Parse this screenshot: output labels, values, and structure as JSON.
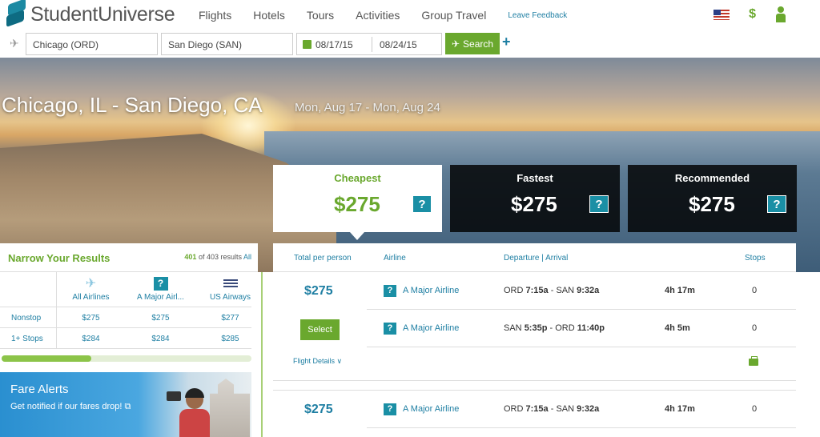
{
  "brand": {
    "name": "StudentUniverse"
  },
  "nav": {
    "links": [
      "Flights",
      "Hotels",
      "Tours",
      "Activities",
      "Group Travel"
    ],
    "feedback": "Leave Feedback",
    "currency_symbol": "$"
  },
  "search": {
    "from": "Chicago (ORD)",
    "to": "San Diego (SAN)",
    "depart_date": "08/17/15",
    "return_date": "08/24/15",
    "search_label": "Search",
    "add_label": "+"
  },
  "hero": {
    "route": "Chicago, IL - San Diego, CA",
    "dates": "Mon, Aug 17 - Mon, Aug 24"
  },
  "tabs": [
    {
      "label": "Cheapest",
      "price": "$275",
      "help": "?"
    },
    {
      "label": "Fastest",
      "price": "$275",
      "help": "?"
    },
    {
      "label": "Recommended",
      "price": "$275",
      "help": "?"
    }
  ],
  "filters": {
    "title": "Narrow Your Results",
    "count_shown": "401",
    "count_rest": " of 403 results ",
    "all_link": "All",
    "columns": [
      "All Airlines",
      "A Major Airl...",
      "US Airways"
    ],
    "column_help": "?",
    "rows": [
      {
        "label": "Nonstop",
        "values": [
          "$275",
          "$275",
          "$277"
        ]
      },
      {
        "label": "1+ Stops",
        "values": [
          "$284",
          "$284",
          "$285"
        ]
      }
    ],
    "progress_fraction": 0.36
  },
  "fare_alert": {
    "title": "Fare Alerts",
    "subtitle": "Get notified if our fares drop! ⧉"
  },
  "results_header": {
    "total": "Total per person",
    "airline": "Airline",
    "dep_arr": "Departure | Arrival",
    "stops": "Stops"
  },
  "results": [
    {
      "price": "$275",
      "select_label": "Select",
      "details_label": "Flight Details ∨",
      "legs": [
        {
          "help": "?",
          "airline": "A Major Airline",
          "from_code": "ORD",
          "dep": "7:15a",
          "to_code": "SAN",
          "arr": "9:32a",
          "duration": "4h 17m",
          "stops": "0"
        },
        {
          "help": "?",
          "airline": "A Major Airline",
          "from_code": "SAN",
          "dep": "5:35p",
          "to_code": "ORD",
          "arr": "11:40p",
          "duration": "4h 5m",
          "stops": "0"
        }
      ]
    },
    {
      "price": "$275",
      "legs": [
        {
          "help": "?",
          "airline": "A Major Airline",
          "from_code": "ORD",
          "dep": "7:15a",
          "to_code": "SAN",
          "arr": "9:32a",
          "duration": "4h 17m",
          "stops": "0"
        }
      ]
    }
  ],
  "colors": {
    "accent_green": "#6aa82e",
    "link_blue": "#1f7fa3",
    "help_teal": "#1a8fa5"
  }
}
